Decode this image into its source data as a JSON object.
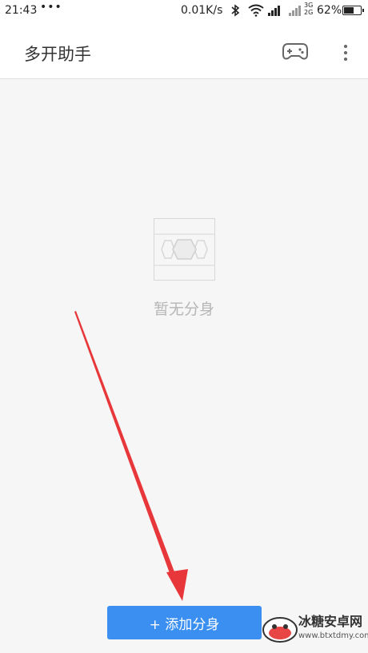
{
  "status_bar": {
    "time": "21:43",
    "dots": "•••",
    "net_speed": "0.01K/s",
    "net_top": "3G",
    "net_bottom": "2G",
    "battery": "62%",
    "battery_level": 0.62,
    "icons": [
      "bluetooth-icon",
      "wifi-icon",
      "signal-icon",
      "battery-icon"
    ]
  },
  "app_bar": {
    "title": "多开助手",
    "icons": [
      "gamepad-icon",
      "more-vert-icon"
    ]
  },
  "empty_state": {
    "icon": "hexagon-placeholder-icon",
    "text": "暂无分身"
  },
  "add_button": {
    "label": "+ 添加分身"
  },
  "watermark": {
    "title": "冰糖安卓网",
    "url": "www.btxtdmy.com"
  },
  "colors": {
    "accent": "#3a8ff0",
    "arrow": "#e8373a",
    "background": "#f6f6f6"
  }
}
